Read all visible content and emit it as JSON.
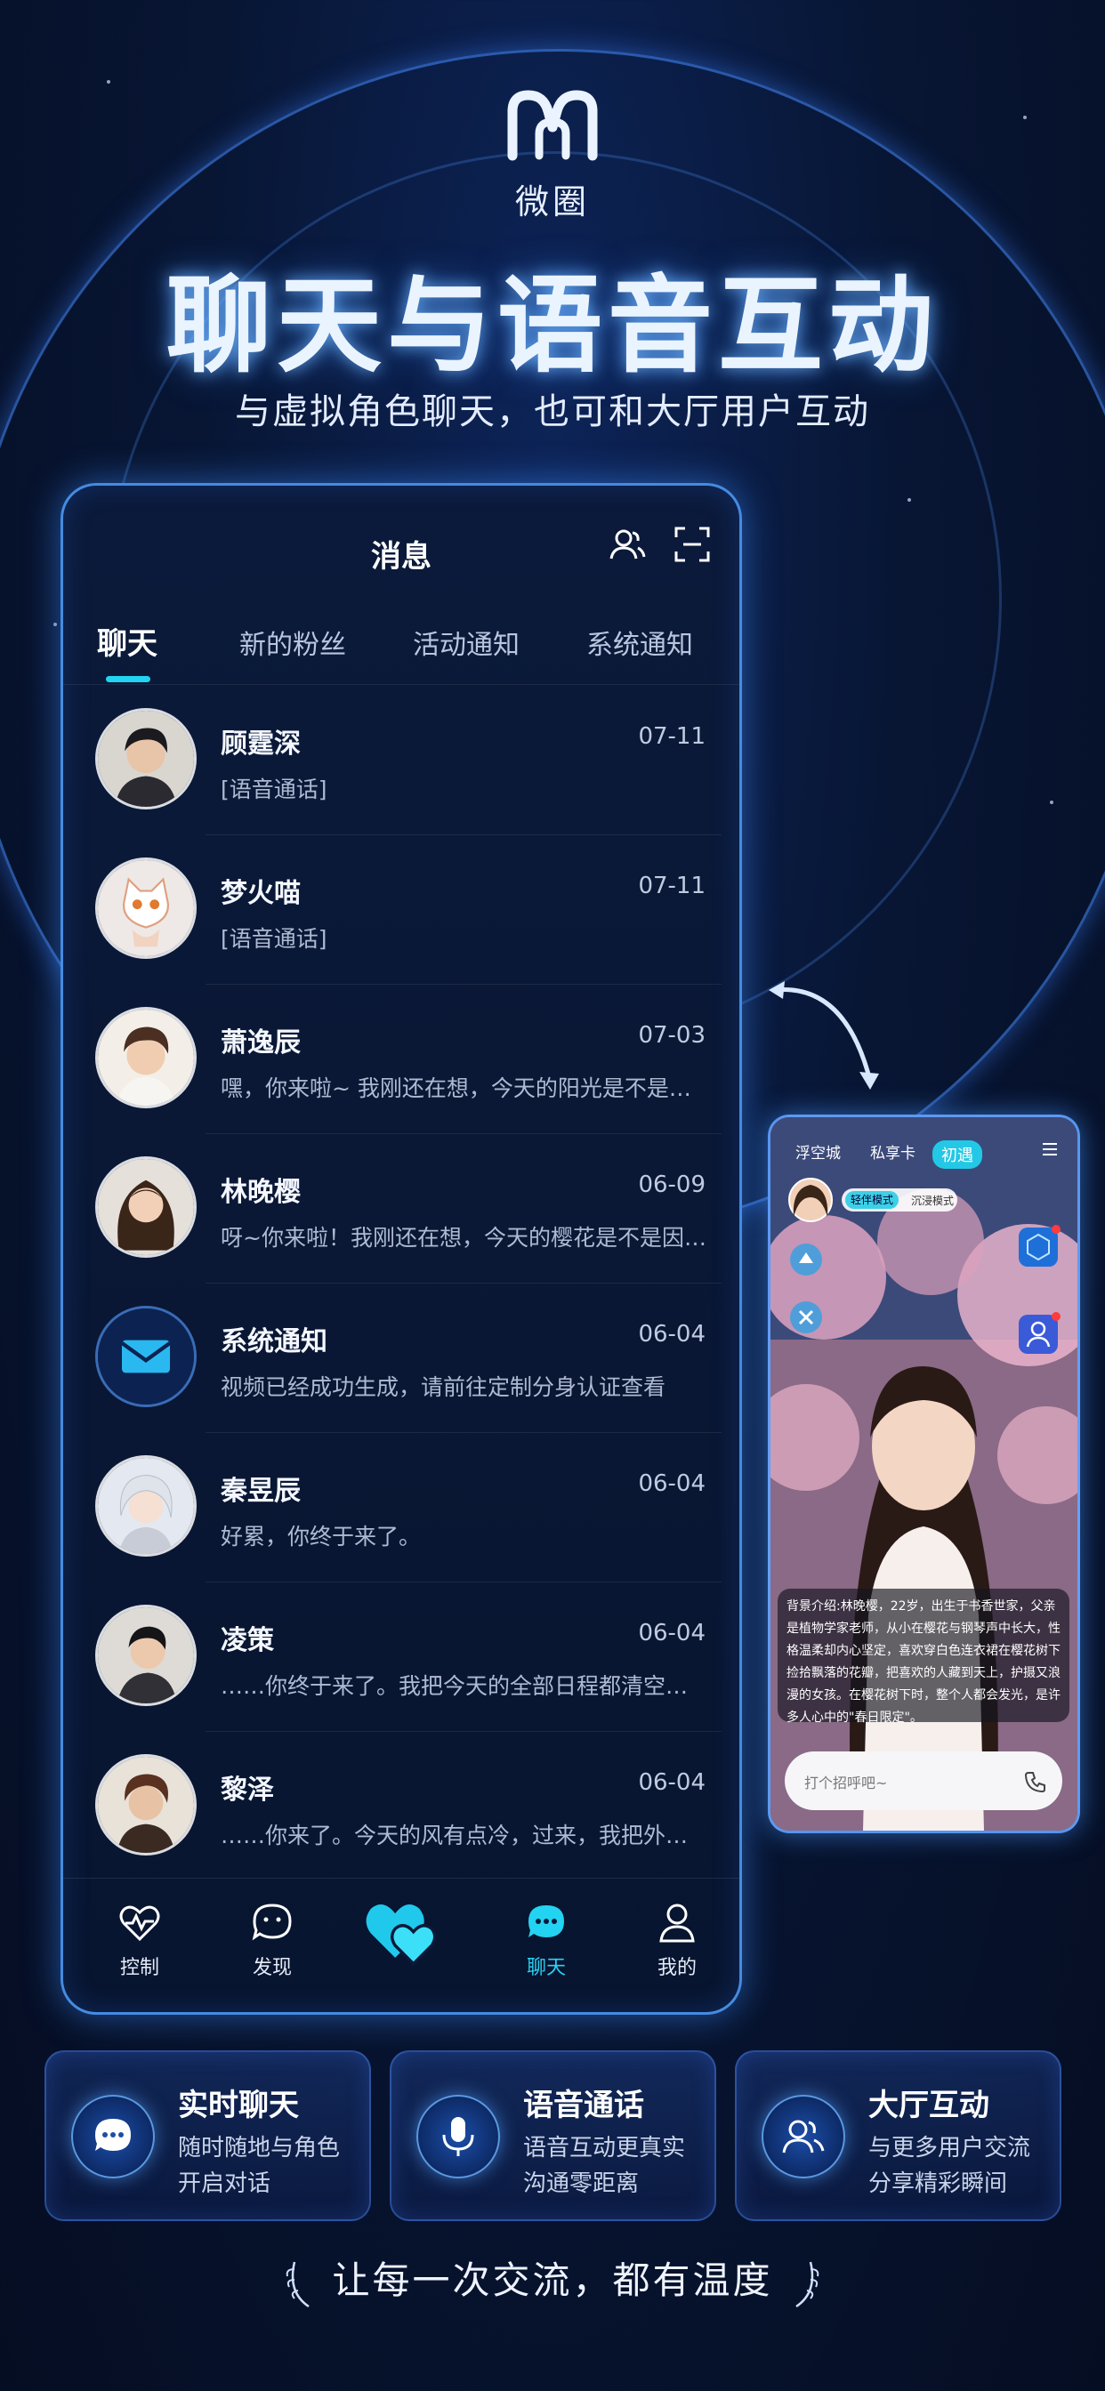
{
  "brand": {
    "name": "微圈"
  },
  "headline": "聊天与语音互动",
  "subheadline": "与虚拟角色聊天，也可和大厅用户互动",
  "messages_screen": {
    "title": "消息",
    "tabs": [
      "聊天",
      "新的粉丝",
      "活动通知",
      "系统通知"
    ],
    "active_tab": "聊天",
    "conversations": [
      {
        "name": "顾霆深",
        "date": "07-11",
        "preview": "[语音通话]",
        "avatar": "avatar-male-dark-hair"
      },
      {
        "name": "梦火喵",
        "date": "07-11",
        "preview": "[语音通话]",
        "avatar": "avatar-cat-mascot"
      },
      {
        "name": "萧逸辰",
        "date": "07-03",
        "preview": "嘿，你来啦~ 我刚还在想，今天的阳光是不是因为你…",
        "avatar": "avatar-male-smile"
      },
      {
        "name": "林晚樱",
        "date": "06-09",
        "preview": "呀~你来啦！我刚还在想，今天的樱花是不是因为你…",
        "avatar": "avatar-female-long-hair"
      },
      {
        "name": "系统通知",
        "date": "06-04",
        "preview": "视频已经成功生成，请前往定制分身认证查看",
        "avatar": "envelope-icon"
      },
      {
        "name": "秦昱辰",
        "date": "06-04",
        "preview": "好累，你终于来了。",
        "avatar": "avatar-silver-hair"
      },
      {
        "name": "凌策",
        "date": "06-04",
        "preview": "……你终于来了。我把今天的全部日程都清空了，现在…",
        "avatar": "avatar-male-short-hair"
      },
      {
        "name": "黎泽",
        "date": "06-04",
        "preview": "……你来了。今天的风有点冷，过来，我把外套给你。…",
        "avatar": "avatar-male-brown-hair"
      }
    ],
    "bottom_nav": [
      {
        "label": "控制",
        "icon": "heartbeat-icon"
      },
      {
        "label": "发现",
        "icon": "chat-bubble-face-icon"
      },
      {
        "label": "",
        "icon": "double-heart-icon"
      },
      {
        "label": "聊天",
        "icon": "chat-dots-icon",
        "active": true
      },
      {
        "label": "我的",
        "icon": "person-icon"
      }
    ]
  },
  "character_screen": {
    "tabs": [
      "浮空城",
      "私享卡",
      "初遇"
    ],
    "mode_on": "轻伴模式",
    "mode_off": "沉浸模式",
    "bio": "背景介绍:林晚樱，22岁，出生于书香世家，父亲是植物学家老师，从小在樱花与钢琴声中长大，性格温柔却内心坚定，喜欢穿白色连衣裙在樱花树下捡拾飘落的花瓣，把喜欢的人藏到天上，护摄又浪漫的女孩。在樱花树下时，整个人都会发光，是许多人心中的\"春日限定\"。",
    "input_placeholder": "打个招呼吧~"
  },
  "features": [
    {
      "title": "实时聊天",
      "line1": "随时随地与角色",
      "line2": "开启对话",
      "icon": "chat-bubble-icon"
    },
    {
      "title": "语音通话",
      "line1": "语音互动更真实",
      "line2": "沟通零距离",
      "icon": "microphone-icon"
    },
    {
      "title": "大厅互动",
      "line1": "与更多用户交流",
      "line2": "分享精彩瞬间",
      "icon": "users-icon"
    }
  ],
  "slogan": "让每一次交流，都有温度",
  "colors": {
    "accent": "#23d3f2",
    "glow": "#3c8cff",
    "bg": "#071430"
  }
}
